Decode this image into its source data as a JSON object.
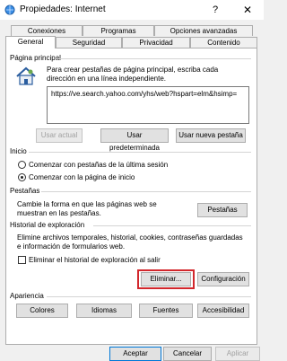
{
  "window": {
    "title": "Propiedades: Internet",
    "help": "?",
    "close": "✕"
  },
  "tabs_row1": [
    "Conexiones",
    "Programas",
    "Opciones avanzadas"
  ],
  "tabs_row2": [
    "General",
    "Seguridad",
    "Privacidad",
    "Contenido"
  ],
  "home": {
    "label": "Página principal",
    "description": "Para crear pestañas de página principal, escriba cada dirección en una línea independiente.",
    "url": "https://ve.search.yahoo.com/yhs/web?hspart=elm&hsimp=",
    "btn_current": "Usar actual",
    "btn_default": "Usar predeterminada",
    "btn_newtab": "Usar nueva pestaña"
  },
  "startup": {
    "label": "Inicio",
    "option_last": "Comenzar con pestañas de la última sesión",
    "option_home": "Comenzar con la página de inicio",
    "selected": "option_home"
  },
  "tabs_group": {
    "label": "Pestañas",
    "description": "Cambie la forma en que las páginas web se muestran en las pestañas.",
    "btn": "Pestañas"
  },
  "history": {
    "label": "Historial de exploración",
    "description": "Elimine archivos temporales, historial, cookies, contraseñas guardadas e información de formularios web.",
    "checkbox_label": "Eliminar el historial de exploración al salir",
    "checkbox_checked": false,
    "btn_delete": "Eliminar...",
    "btn_settings": "Configuración"
  },
  "appearance": {
    "label": "Apariencia",
    "btn_colors": "Colores",
    "btn_languages": "Idiomas",
    "btn_fonts": "Fuentes",
    "btn_accessibility": "Accesibilidad"
  },
  "footer": {
    "ok": "Aceptar",
    "cancel": "Cancelar",
    "apply": "Aplicar"
  },
  "colors": {
    "highlight": "#d2272c",
    "focus": "#0078d7"
  },
  "icons": {
    "title": "internet-options-icon",
    "home": "house-icon"
  }
}
